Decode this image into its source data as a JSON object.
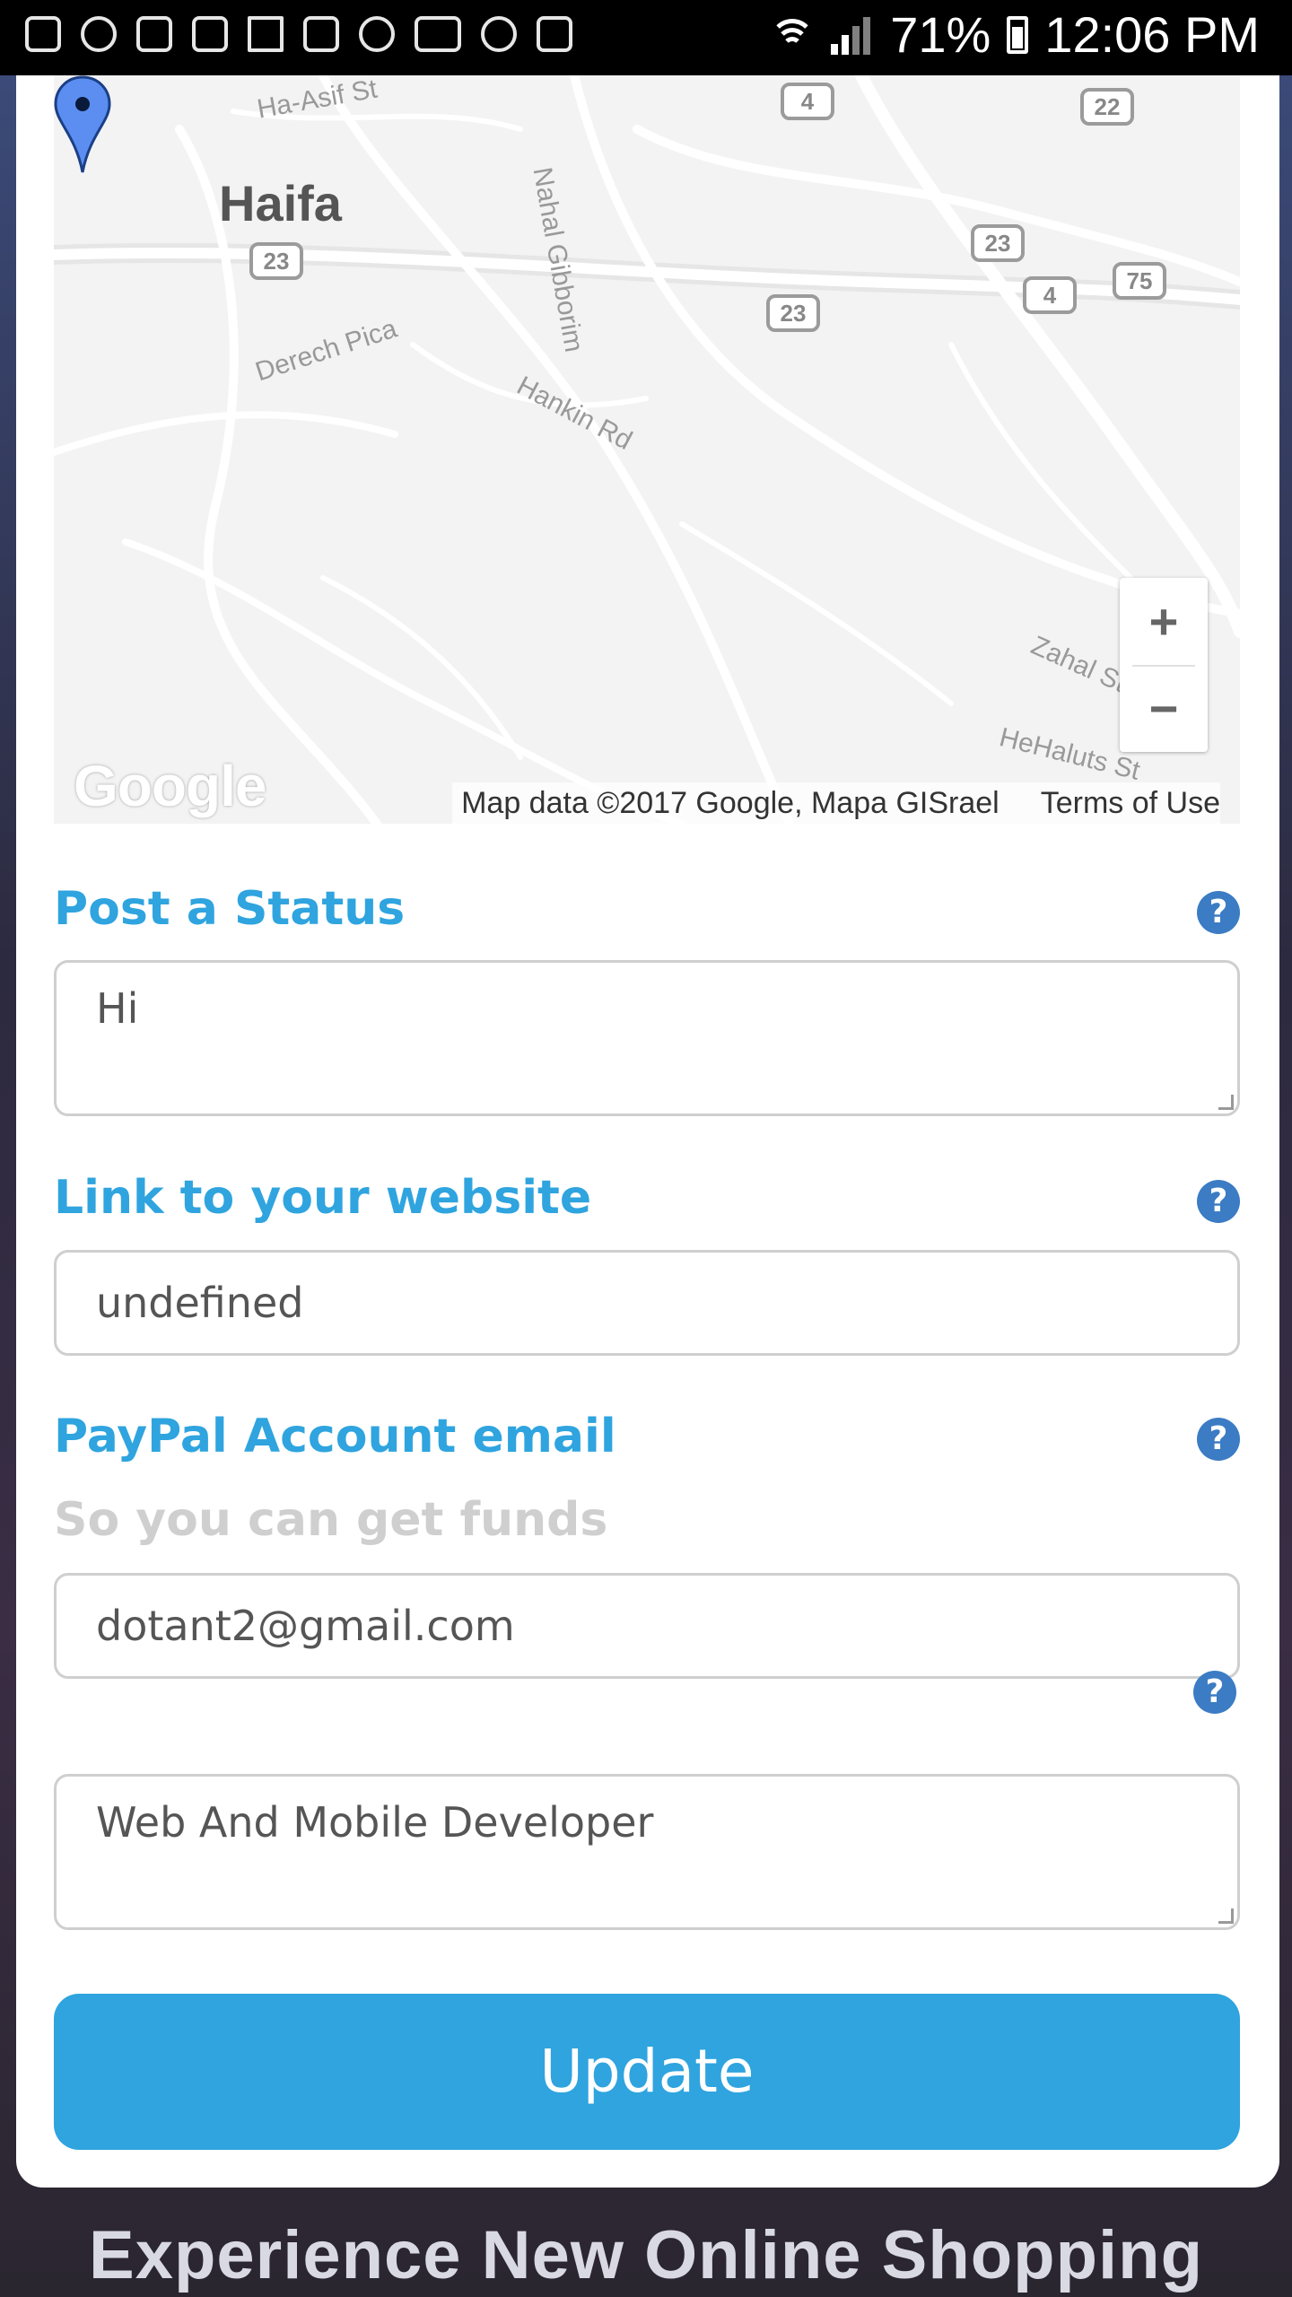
{
  "status_bar": {
    "battery": "71%",
    "time": "12:06 PM"
  },
  "map": {
    "city": "Haifa",
    "streets": [
      "Ha-Asif St",
      "Nahal Gibborim",
      "Derech Pica",
      "Hankin Rd",
      "Zahal St",
      "HeHaluts St"
    ],
    "route_shields": [
      "4",
      "22",
      "23",
      "23",
      "23",
      "4",
      "75"
    ],
    "zoom_in": "+",
    "zoom_out": "−",
    "logo": "Google",
    "attribution": "Map data ©2017 Google, Mapa GISrael",
    "terms": "Terms of Use"
  },
  "form": {
    "status_label": "Post a Status",
    "status_value": "Hi",
    "website_label": "Link to your website",
    "website_value": "undefined",
    "paypal_label": "PayPal Account email",
    "paypal_sublabel": "So you can get funds",
    "paypal_value": "dotant2@gmail.com",
    "bio_value": "Web And Mobile Developer",
    "help_glyph": "?",
    "update_button": "Update"
  },
  "background": {
    "headline": "Experience New Online Shopping"
  },
  "colors": {
    "accent": "#2fa4df",
    "help_icon": "#3b7cc4",
    "sublabel": "#cfcfcf"
  }
}
